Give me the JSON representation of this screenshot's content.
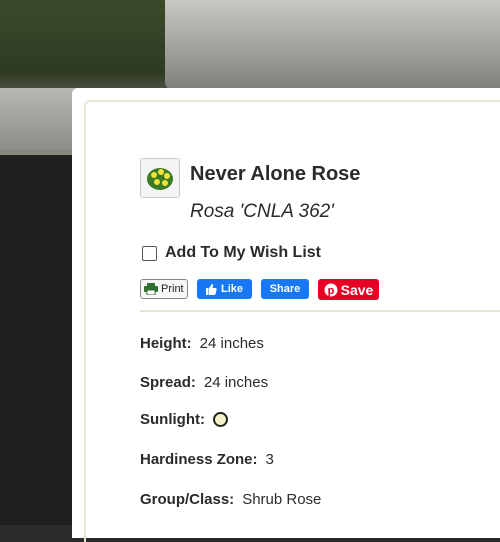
{
  "plant": {
    "common_name": "Never Alone Rose",
    "latin_name": "Rosa 'CNLA 362'"
  },
  "wishlist": {
    "label": "Add To My Wish List",
    "checked": false
  },
  "share": {
    "print_label": "Print",
    "like_label": "Like",
    "share_label": "Share",
    "save_label": "Save"
  },
  "attributes": {
    "height": {
      "label": "Height:",
      "value": "24 inches"
    },
    "spread": {
      "label": "Spread:",
      "value": "24 inches"
    },
    "sunlight": {
      "label": "Sunlight:",
      "icon": "full-sun-icon"
    },
    "hardiness": {
      "label": "Hardiness Zone:",
      "value": "3"
    },
    "group": {
      "label": "Group/Class:",
      "value": "Shrub Rose"
    }
  },
  "colors": {
    "accent_green": "#dfe8d2",
    "facebook_blue": "#1877f2",
    "pinterest_red": "#e60023"
  }
}
